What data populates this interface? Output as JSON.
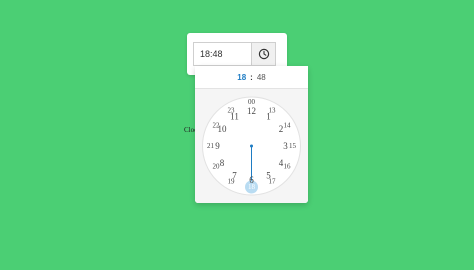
{
  "input": {
    "value": "18:48"
  },
  "side_label": "Clock",
  "clock_button": {
    "icon": "clock-icon"
  },
  "header": {
    "hours": "18",
    "separator": ":",
    "minutes": "48"
  },
  "dial": {
    "outer_hours": [
      "00",
      "1",
      "2",
      "3",
      "4",
      "5",
      "6",
      "7",
      "8",
      "9",
      "10",
      "11",
      "12"
    ],
    "inner_hours": [
      "13",
      "14",
      "15",
      "16",
      "17",
      "18",
      "19",
      "20",
      "21",
      "22",
      "23"
    ],
    "selected": "18"
  },
  "colors": {
    "background": "#4bcf74",
    "accent": "#1e7cc3",
    "selected_fill": "#b9dcf2"
  }
}
